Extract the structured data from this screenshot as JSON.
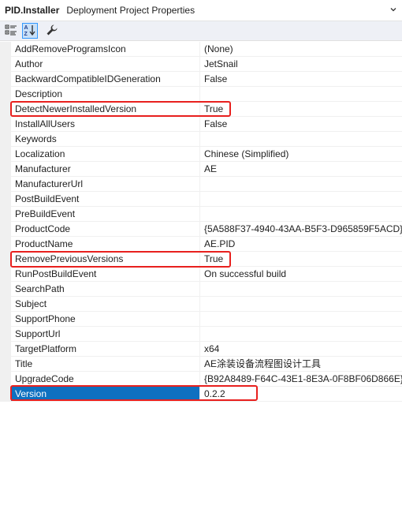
{
  "header": {
    "object_name": "PID.Installer",
    "object_type": "Deployment Project Properties"
  },
  "toolbar": {
    "categorized_icon": "categorized-icon",
    "alphabetical_icon": "alphabetical-sort-icon",
    "property_pages_icon": "wrench-icon"
  },
  "properties": [
    {
      "name": "AddRemoveProgramsIcon",
      "value": "(None)"
    },
    {
      "name": "Author",
      "value": "JetSnail"
    },
    {
      "name": "BackwardCompatibleIDGeneration",
      "value": "False"
    },
    {
      "name": "Description",
      "value": ""
    },
    {
      "name": "DetectNewerInstalledVersion",
      "value": "True"
    },
    {
      "name": "InstallAllUsers",
      "value": "False"
    },
    {
      "name": "Keywords",
      "value": ""
    },
    {
      "name": "Localization",
      "value": "Chinese (Simplified)"
    },
    {
      "name": "Manufacturer",
      "value": "AE"
    },
    {
      "name": "ManufacturerUrl",
      "value": ""
    },
    {
      "name": "PostBuildEvent",
      "value": ""
    },
    {
      "name": "PreBuildEvent",
      "value": ""
    },
    {
      "name": "ProductCode",
      "value": "{5A588F37-4940-43AA-B5F3-D965859F5ACD}"
    },
    {
      "name": "ProductName",
      "value": "AE.PID"
    },
    {
      "name": "RemovePreviousVersions",
      "value": "True"
    },
    {
      "name": "RunPostBuildEvent",
      "value": "On successful build"
    },
    {
      "name": "SearchPath",
      "value": ""
    },
    {
      "name": "Subject",
      "value": ""
    },
    {
      "name": "SupportPhone",
      "value": ""
    },
    {
      "name": "SupportUrl",
      "value": ""
    },
    {
      "name": "TargetPlatform",
      "value": "x64"
    },
    {
      "name": "Title",
      "value": "AE涂装设备流程图设计工具"
    },
    {
      "name": "UpgradeCode",
      "value": "{B92A8489-F64C-43E1-8E3A-0F8BF06D866E}"
    },
    {
      "name": "Version",
      "value": "0.2.2"
    }
  ],
  "selected_property": "Version",
  "highlighted_properties": [
    "DetectNewerInstalledVersion",
    "RemovePreviousVersions",
    "Version"
  ],
  "colors": {
    "selection": "#0e70c0",
    "highlight_box": "#e8201e",
    "toolbar_bg": "#eef0f6",
    "pressed_button": "#c9e0f7"
  }
}
